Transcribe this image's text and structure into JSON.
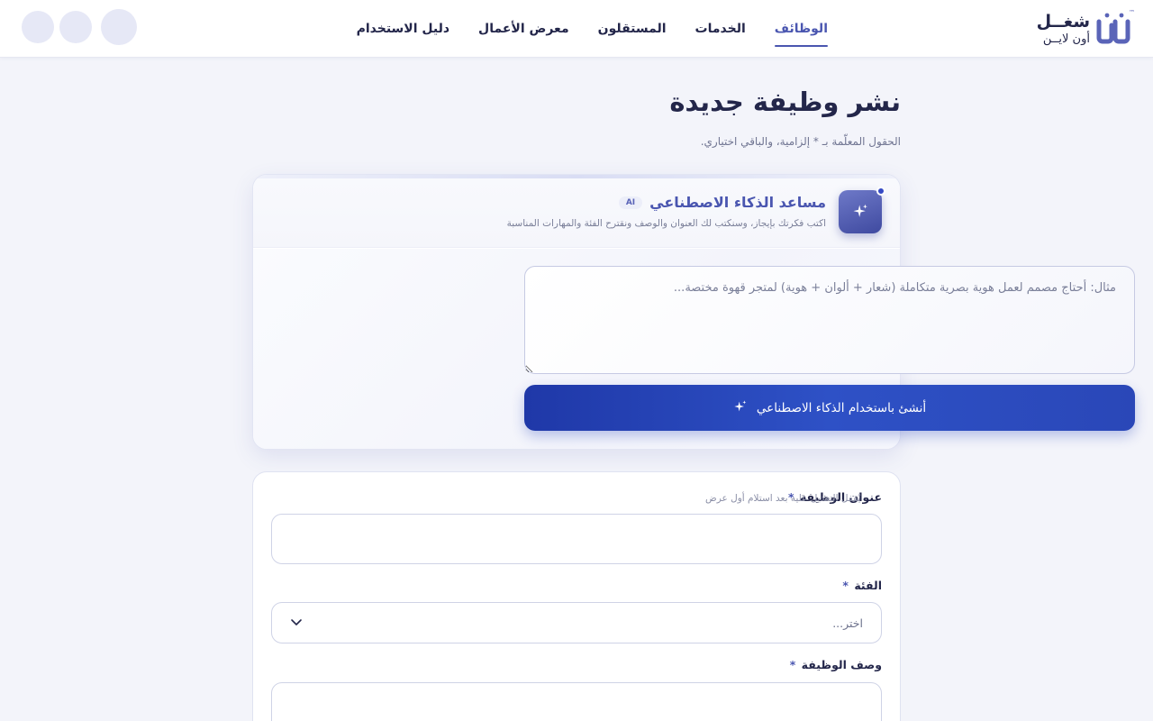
{
  "header": {
    "logo_main": "شغــل",
    "logo_sub": "أون لايــن",
    "logo_tm": "™",
    "nav": [
      "الوظائف",
      "الخدمات",
      "المستقلون",
      "معرض الأعمال",
      "دليل الاستخدام"
    ],
    "active_nav": "الوظائف"
  },
  "page": {
    "title": "نشر وظيفة جديدة",
    "subtitle": "الحقول المعلّمة بـ * إلزامية، والباقي اختياري."
  },
  "ai_assistant": {
    "title": "مساعد الذكاء الاصطناعي",
    "badge": "AI",
    "description": "اكتب فكرتك بإيجاز، وسنكتب لك العنوان والوصف ونقترح الفئة والمهارات المناسبة",
    "prompt_placeholder": "مثال: أحتاج مصمم لعمل هوية بصرية متكاملة (شعار + ألوان + هوية) لمتجر قهوة مختصة...",
    "prompt_value": "",
    "generate_label": "أنشئ باستخدام الذكاء الاصطناعي"
  },
  "form": {
    "job_title_label": "عنوان الوظيفة",
    "job_title_hint": "يُقفل التعديل عليه بعد استلام أول عرض",
    "job_title_value": "",
    "category_label": "الفئة",
    "category_value": "اختر...",
    "description_label": "وصف الوظيفة",
    "description_value": "",
    "required_mark": "*"
  },
  "colors": {
    "accent": "#4a56b0",
    "button": "#2a47b8",
    "background": "#f3f4fa"
  }
}
